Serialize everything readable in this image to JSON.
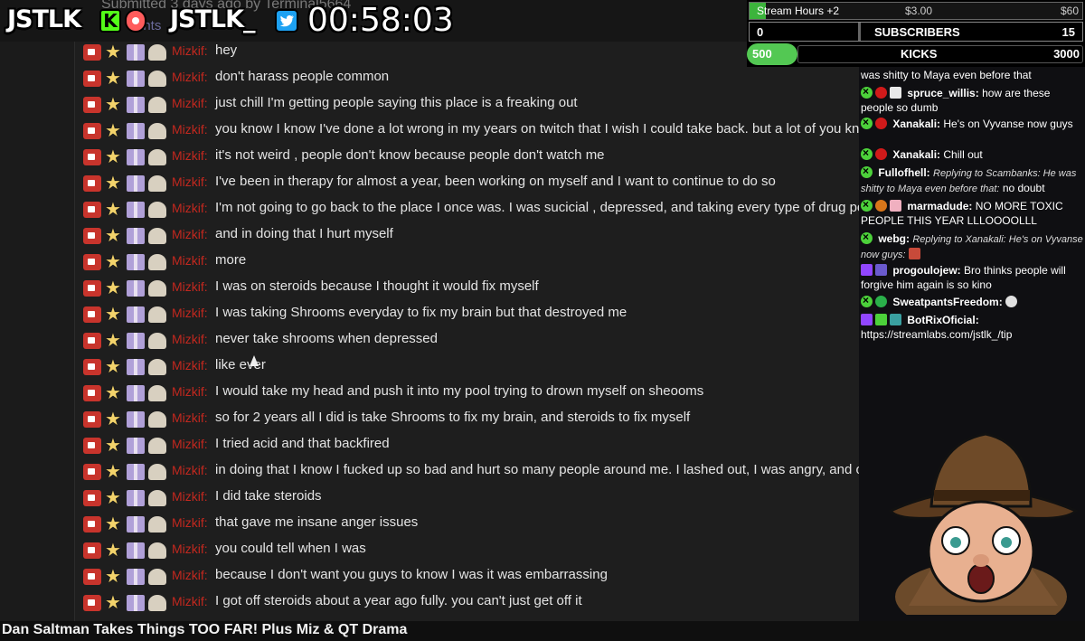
{
  "header": {
    "submitted": "Submitted 3 days ago by Terminal5664",
    "submitted_tail": "ents",
    "brand_left": "JSTLK",
    "brand_mid": "JSTLK_",
    "kick_letter": "K",
    "timer": "00:58:03"
  },
  "goals": {
    "stream_hours_label": "Stream Hours +2",
    "stream_hours_mid": "$3.00",
    "stream_hours_end": "$60",
    "stream_hours_progress": 0.05,
    "subs_current": "0",
    "subs_label": "SUBSCRIBERS",
    "subs_goal": "15",
    "kicks_current": "500",
    "kicks_label": "KICKS",
    "kicks_goal": "3000"
  },
  "chat_username": "Mizkif:",
  "chat_messages": [
    "hey",
    "don't harass people common",
    "just chill I'm getting people saying this place is a freaking out",
    "you know I know I've done a lot wrong in my years on twitch that I wish I could take back. but a lot of you kno",
    "it's not weird , people don't know because people don't watch me",
    "I've been in therapy for almost a year, been working on myself and I want to continue to do so",
    "I'm not going to go back to the place I once was. I was sucicial , depressed, and taking every type of drug pos",
    "and in doing that I hurt myself",
    "more",
    "I was on steroids because I thought it would fix myself",
    "I was taking Shrooms everyday to fix my brain but that destroyed me",
    "never take shrooms when depressed",
    "like ever",
    "I would take my head and push it into my pool trying to drown myself on sheooms",
    "so for 2 years all I did is take Shrooms to fix my brain, and steroids to fix myself",
    "I tried acid and that backfired",
    "in doing that I know I fucked up so bad and hurt so many people around me. I lashed out, I was angry, and ou",
    "I did take steroids",
    "that gave me insane anger issues",
    "you could tell when I was",
    "because I don't want you guys to know I was it was embarrassing",
    "I got off steroids about a year ago fully. you can't just get off it"
  ],
  "side_chat": {
    "top_line": "was shitty to Maya even before that",
    "m1_user": "spruce_willis:",
    "m1_text": "how are these people so dumb",
    "m2_user": "Xanakali:",
    "m2_text": "He's on Vyvanse now guys",
    "m3_user": "Xanakali:",
    "m3_text": "Chill out",
    "m4_user": "Fullofhell:",
    "m4_reply": "Replying to Scambanks: He was shitty to Maya even before that:",
    "m4_text": "no doubt",
    "m5_user": "marmadude:",
    "m5_text": "NO MORE TOXIC PEOPLE THIS YEAR LLLOOOOLLL",
    "m6_user": "webg:",
    "m6_reply": "Replying to Xanakali: He's on Vyvanse now guys:",
    "m7_user": "progoulojew:",
    "m7_text": "Bro thinks people will forgive him again is so kino",
    "m8_user": "SweatpantsFreedom:",
    "m9_user": "BotRixOficial:",
    "m9_text": "https://streamlabs.com/jstlk_/tip"
  },
  "video_title": "Dan Saltman Takes Things TOO FAR! Plus Miz & QT Drama",
  "colors": {
    "kick_green": "#53fc18",
    "mizkif_red": "#c2281f",
    "twitter_blue": "#1da1f2"
  }
}
